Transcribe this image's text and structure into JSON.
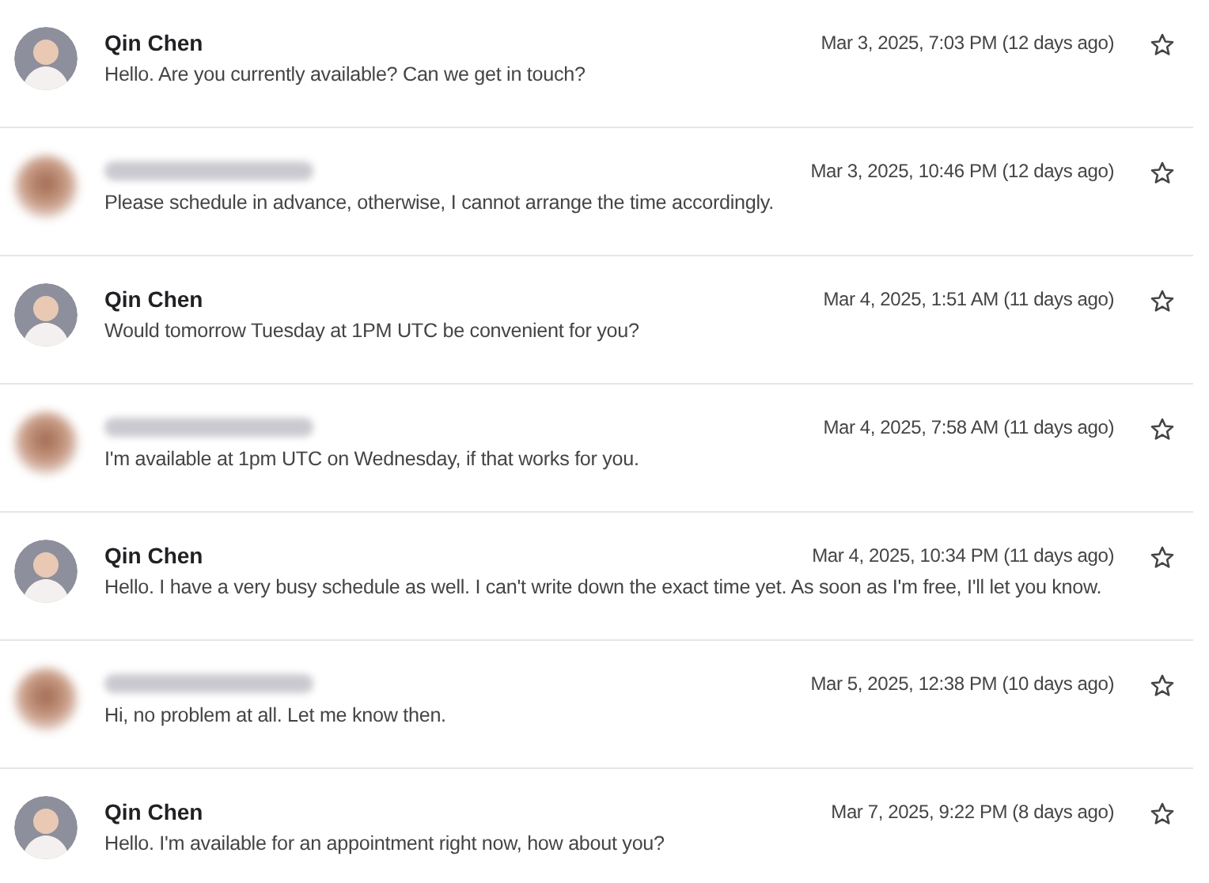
{
  "messages": [
    {
      "sender": {
        "kind": "named",
        "name": "Qin Chen"
      },
      "date": "Mar 3, 2025, 7:03 PM (12 days ago)",
      "text": "Hello. Are you currently available? Can we get in touch?",
      "starred": false
    },
    {
      "sender": {
        "kind": "redacted"
      },
      "date": "Mar 3, 2025, 10:46 PM (12 days ago)",
      "text": "Please schedule in advance, otherwise, I cannot arrange the time accordingly.",
      "starred": false
    },
    {
      "sender": {
        "kind": "named",
        "name": "Qin Chen"
      },
      "date": "Mar 4, 2025, 1:51 AM (11 days ago)",
      "text": "Would tomorrow Tuesday at 1PM UTC be convenient for you?",
      "starred": false
    },
    {
      "sender": {
        "kind": "redacted"
      },
      "date": "Mar 4, 2025, 7:58 AM (11 days ago)",
      "text": "I'm available at 1pm UTC on Wednesday, if that works for you.",
      "starred": false
    },
    {
      "sender": {
        "kind": "named",
        "name": "Qin Chen"
      },
      "date": "Mar 4, 2025, 10:34 PM (11 days ago)",
      "text": "Hello. I have a very busy schedule as well. I can't write down the exact time yet. As soon as I'm free, I'll let you know.",
      "starred": false
    },
    {
      "sender": {
        "kind": "redacted"
      },
      "date": "Mar 5, 2025, 12:38 PM (10 days ago)",
      "text": "Hi, no problem at all. Let me know then.",
      "starred": false
    },
    {
      "sender": {
        "kind": "named",
        "name": "Qin Chen"
      },
      "date": "Mar 7, 2025, 9:22 PM (8 days ago)",
      "text": "Hello. I'm available for an appointment right now, how about you?",
      "starred": false
    }
  ]
}
